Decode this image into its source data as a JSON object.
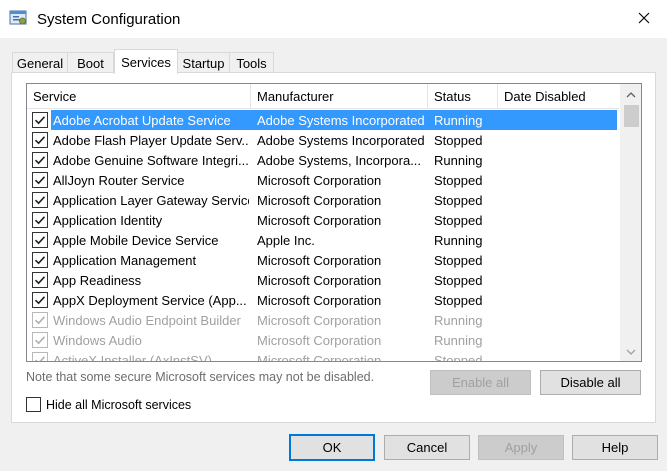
{
  "window": {
    "title": "System Configuration",
    "icon": "msconfig-icon",
    "close_icon": "close-icon"
  },
  "tabs": [
    {
      "label": "General"
    },
    {
      "label": "Boot"
    },
    {
      "label": "Services",
      "active": true
    },
    {
      "label": "Startup"
    },
    {
      "label": "Tools"
    }
  ],
  "services": {
    "columns": [
      "Service",
      "Manufacturer",
      "Status",
      "Date Disabled"
    ],
    "rows": [
      {
        "checked": true,
        "enabled": true,
        "selected": true,
        "service": "Adobe Acrobat Update Service",
        "manufacturer": "Adobe Systems Incorporated",
        "status": "Running",
        "date_disabled": ""
      },
      {
        "checked": true,
        "enabled": true,
        "selected": false,
        "service": "Adobe Flash Player Update Serv...",
        "manufacturer": "Adobe Systems Incorporated",
        "status": "Stopped",
        "date_disabled": ""
      },
      {
        "checked": true,
        "enabled": true,
        "selected": false,
        "service": "Adobe Genuine Software Integri...",
        "manufacturer": "Adobe Systems, Incorpora...",
        "status": "Running",
        "date_disabled": ""
      },
      {
        "checked": true,
        "enabled": true,
        "selected": false,
        "service": "AllJoyn Router Service",
        "manufacturer": "Microsoft Corporation",
        "status": "Stopped",
        "date_disabled": ""
      },
      {
        "checked": true,
        "enabled": true,
        "selected": false,
        "service": "Application Layer Gateway Service",
        "manufacturer": "Microsoft Corporation",
        "status": "Stopped",
        "date_disabled": ""
      },
      {
        "checked": true,
        "enabled": true,
        "selected": false,
        "service": "Application Identity",
        "manufacturer": "Microsoft Corporation",
        "status": "Stopped",
        "date_disabled": ""
      },
      {
        "checked": true,
        "enabled": true,
        "selected": false,
        "service": "Apple Mobile Device Service",
        "manufacturer": "Apple Inc.",
        "status": "Running",
        "date_disabled": ""
      },
      {
        "checked": true,
        "enabled": true,
        "selected": false,
        "service": "Application Management",
        "manufacturer": "Microsoft Corporation",
        "status": "Stopped",
        "date_disabled": ""
      },
      {
        "checked": true,
        "enabled": true,
        "selected": false,
        "service": "App Readiness",
        "manufacturer": "Microsoft Corporation",
        "status": "Stopped",
        "date_disabled": ""
      },
      {
        "checked": true,
        "enabled": true,
        "selected": false,
        "service": "AppX Deployment Service (App...",
        "manufacturer": "Microsoft Corporation",
        "status": "Stopped",
        "date_disabled": ""
      },
      {
        "checked": true,
        "enabled": false,
        "selected": false,
        "service": "Windows Audio Endpoint Builder",
        "manufacturer": "Microsoft Corporation",
        "status": "Running",
        "date_disabled": ""
      },
      {
        "checked": true,
        "enabled": false,
        "selected": false,
        "service": "Windows Audio",
        "manufacturer": "Microsoft Corporation",
        "status": "Running",
        "date_disabled": ""
      },
      {
        "checked": true,
        "enabled": false,
        "selected": false,
        "service": "ActiveX Installer (AxInstSV)",
        "manufacturer": "Microsoft Corporation",
        "status": "Stopped",
        "date_disabled": ""
      }
    ]
  },
  "note": "Note that some secure Microsoft services may not be disabled.",
  "enable_all": {
    "label": "Enable all",
    "enabled": false
  },
  "disable_all": {
    "label": "Disable all",
    "enabled": true
  },
  "hide_ms": {
    "label": "Hide all Microsoft services",
    "checked": false
  },
  "buttons": {
    "ok": "OK",
    "cancel": "Cancel",
    "apply": "Apply",
    "help": "Help"
  },
  "colors": {
    "selection": "#3399ff",
    "default_button_border": "#0078d7",
    "disabled_text": "#a0a0a0"
  }
}
